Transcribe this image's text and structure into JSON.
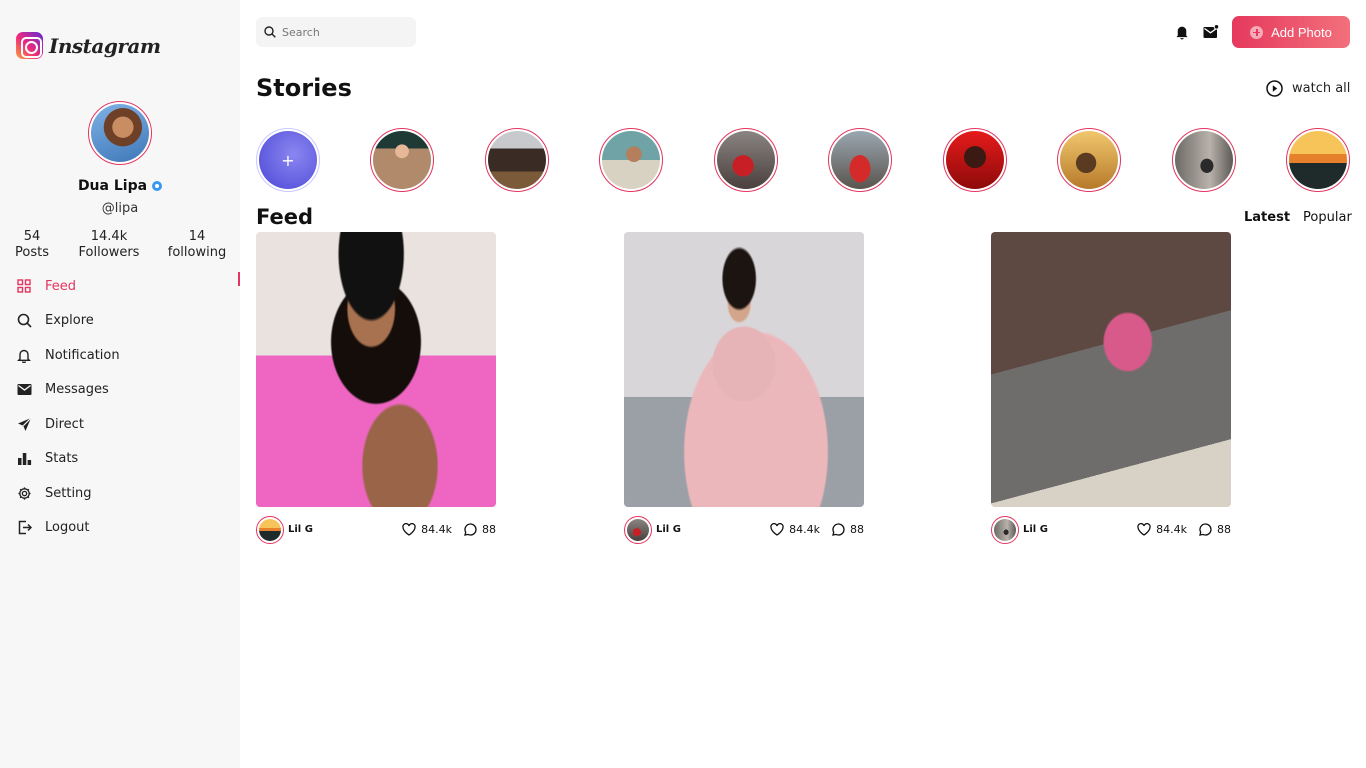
{
  "brand": {
    "name": "Instagram"
  },
  "profile": {
    "name": "Dua Lipa",
    "handle": "@lipa",
    "stats": [
      {
        "value": "54",
        "label": "Posts"
      },
      {
        "value": "14.4k",
        "label": "Followers"
      },
      {
        "value": "14",
        "label": "following"
      }
    ]
  },
  "nav": [
    {
      "label": "Feed",
      "icon": "grid-icon",
      "active": true
    },
    {
      "label": "Explore",
      "icon": "search-icon"
    },
    {
      "label": "Notification",
      "icon": "bell-icon"
    },
    {
      "label": "Messages",
      "icon": "mail-icon"
    },
    {
      "label": "Direct",
      "icon": "send-icon"
    },
    {
      "label": "Stats",
      "icon": "bar-chart-icon"
    },
    {
      "label": "Setting",
      "icon": "gear-icon"
    },
    {
      "label": "Logout",
      "icon": "logout-icon"
    }
  ],
  "search": {
    "placeholder": "Search"
  },
  "header": {
    "add_photo_label": "Add Photo"
  },
  "stories": {
    "title": "Stories",
    "watch_all_label": "watch all",
    "add_label": "+"
  },
  "feed": {
    "title": "Feed",
    "tabs": [
      "Latest",
      "Popular"
    ],
    "active_tab": "Latest",
    "posts": [
      {
        "author": "Lil G",
        "likes": "84.4k",
        "comments": "88"
      },
      {
        "author": "Lil G",
        "likes": "84.4k",
        "comments": "88"
      },
      {
        "author": "Lil G",
        "likes": "84.4k",
        "comments": "88"
      }
    ]
  },
  "colors": {
    "accent": "#e3355f",
    "verified": "#3897f0"
  }
}
